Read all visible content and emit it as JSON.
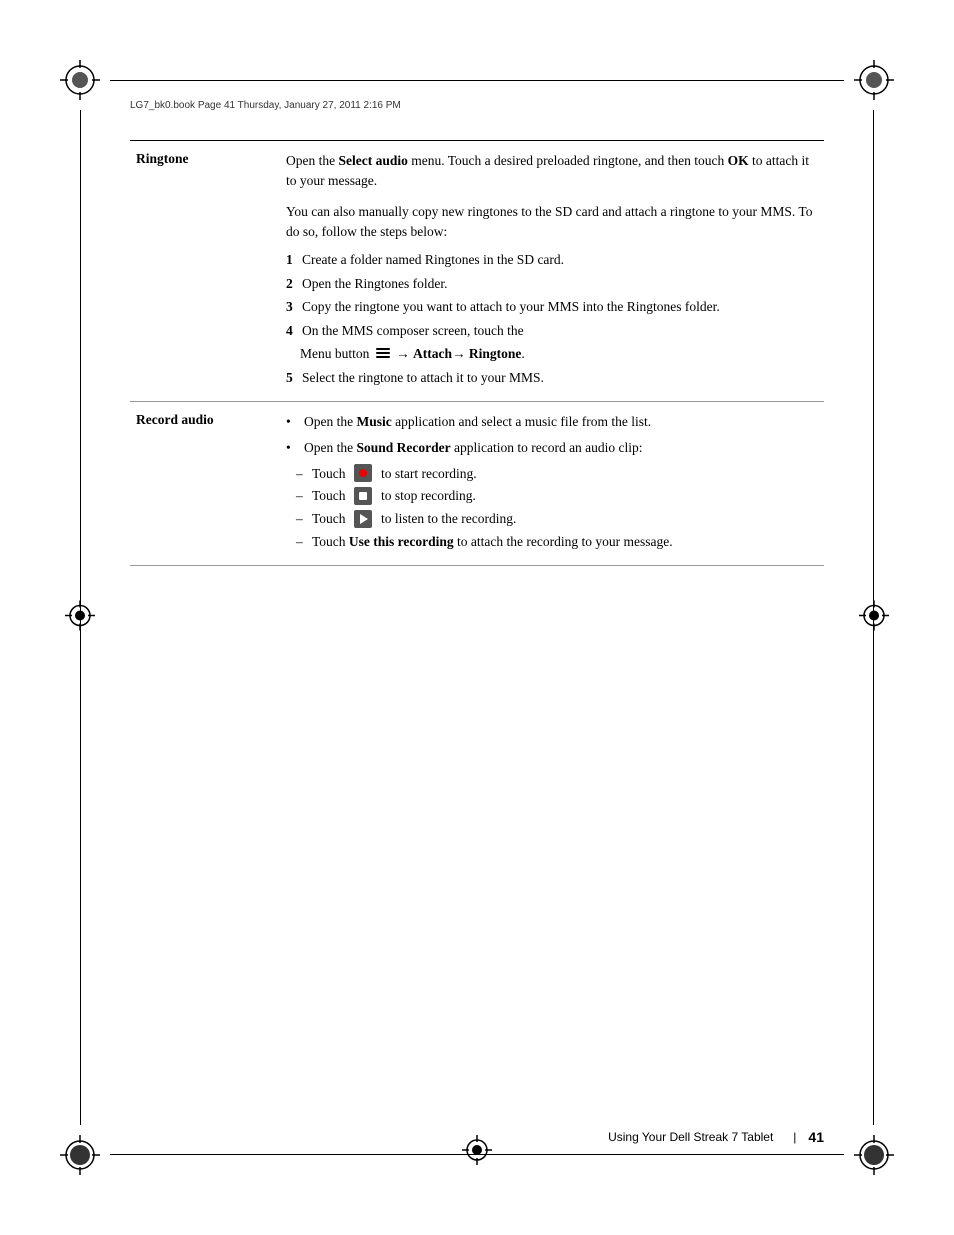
{
  "meta": {
    "file_info": "LG7_bk0.book  Page 41  Thursday, January 27, 2011  2:16 PM"
  },
  "footer": {
    "label": "Using Your Dell Streak 7 Tablet",
    "separator": "|",
    "page_number": "41"
  },
  "content": {
    "rows": [
      {
        "id": "ringtone",
        "label": "Ringtone",
        "paragraphs": [
          {
            "type": "text",
            "text_parts": [
              {
                "text": "Open the ",
                "bold": false
              },
              {
                "text": "Select audio",
                "bold": true
              },
              {
                "text": " menu. Touch a desired preloaded ringtone, and then touch ",
                "bold": false
              },
              {
                "text": "OK",
                "bold": true
              },
              {
                "text": " to attach it to your message.",
                "bold": false
              }
            ]
          },
          {
            "type": "text",
            "text_parts": [
              {
                "text": "You can also manually copy new ringtones to the SD card and attach a ringtone to your MMS. To do so, follow the steps below:",
                "bold": false
              }
            ]
          },
          {
            "type": "numbered",
            "items": [
              {
                "num": "1",
                "text_parts": [
                  {
                    "text": "Create a folder named Ringtones in the SD card.",
                    "bold": false
                  }
                ]
              },
              {
                "num": "2",
                "text_parts": [
                  {
                    "text": "Open the Ringtones folder.",
                    "bold": false
                  }
                ]
              },
              {
                "num": "3",
                "text_parts": [
                  {
                    "text": "Copy the ringtone you want to attach to your MMS into the Ringtones folder.",
                    "bold": false
                  }
                ]
              },
              {
                "num": "4",
                "text_parts": [
                  {
                    "text": "On the MMS composer screen, touch the",
                    "bold": false
                  }
                ],
                "has_menu_line": true
              },
              {
                "num": "5",
                "text_parts": [
                  {
                    "text": "Select the ringtone to attach it to your MMS.",
                    "bold": false
                  }
                ]
              }
            ]
          }
        ]
      },
      {
        "id": "record_audio",
        "label": "Record audio",
        "bullets": [
          {
            "text_parts": [
              {
                "text": "Open the ",
                "bold": false
              },
              {
                "text": "Music",
                "bold": true
              },
              {
                "text": " application and select a music file from the list.",
                "bold": false
              }
            ]
          },
          {
            "text_parts": [
              {
                "text": "Open the ",
                "bold": false
              },
              {
                "text": "Sound Recorder",
                "bold": true
              },
              {
                "text": " application to record an audio clip:",
                "bold": false
              }
            ],
            "dashes": [
              {
                "icon": "record",
                "text_parts": [
                  {
                    "text": " to start recording.",
                    "bold": false
                  }
                ]
              },
              {
                "icon": "stop",
                "text_parts": [
                  {
                    "text": " to stop recording.",
                    "bold": false
                  }
                ]
              },
              {
                "icon": "play",
                "text_parts": [
                  {
                    "text": " to listen to the recording.",
                    "bold": false
                  }
                ]
              },
              {
                "icon": "none",
                "text_parts": [
                  {
                    "text": "Use this recording",
                    "bold": true
                  },
                  {
                    "text": " to attach the recording to your message.",
                    "bold": false
                  }
                ]
              }
            ]
          }
        ]
      }
    ]
  }
}
